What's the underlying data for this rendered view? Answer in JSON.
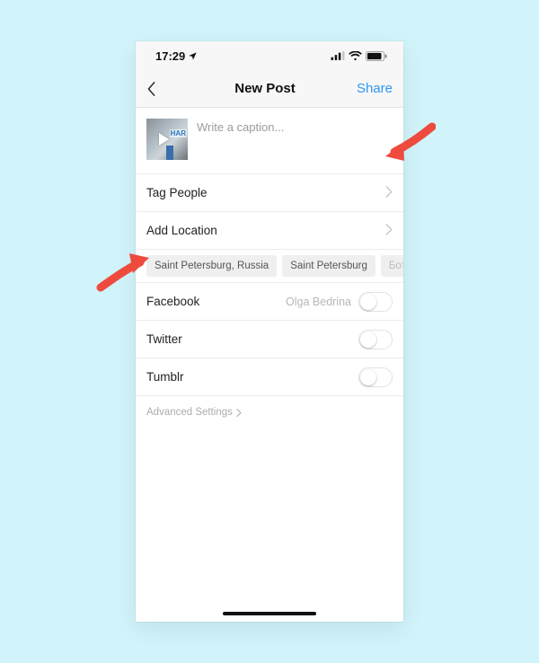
{
  "status": {
    "time": "17:29"
  },
  "nav": {
    "title": "New Post",
    "share": "Share"
  },
  "caption": {
    "placeholder": "Write a caption...",
    "thumb_label": "HAR"
  },
  "rows": {
    "tag_people": "Tag People",
    "add_location": "Add Location"
  },
  "location_chips": [
    "Saint Petersburg, Russia",
    "Saint Petersburg",
    "Бот"
  ],
  "share": {
    "facebook": {
      "label": "Facebook",
      "account": "Olga Bedrina",
      "on": false
    },
    "twitter": {
      "label": "Twitter",
      "on": false
    },
    "tumblr": {
      "label": "Tumblr",
      "on": false
    }
  },
  "advanced": "Advanced Settings"
}
